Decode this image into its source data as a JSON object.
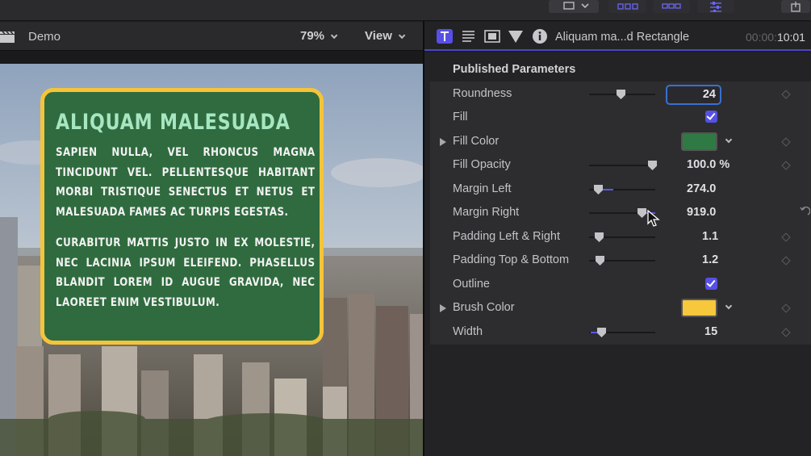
{
  "colors": {
    "accent": "#5650e6",
    "card_fill": "#2f6b3e",
    "card_border": "#f4c43a",
    "card_title": "#a6e6c1",
    "fill_color_swatch": "#2f7a44",
    "brush_color_swatch": "#f7c73c"
  },
  "icons": {
    "toolbar": [
      "display-icon",
      "chevron-down-icon",
      "grid-view-icon",
      "filmstrip-icon",
      "sliders-icon",
      "share-icon"
    ],
    "viewer": [
      "clapperboard-icon"
    ],
    "inspector_tabs": [
      "text-inspector-icon",
      "title-inspector-icon",
      "video-inspector-icon",
      "filter-icon",
      "info-icon"
    ],
    "row_actions": [
      "keyframe-diamond-icon",
      "reset-arrow-icon",
      "triangle-disclosure-icon",
      "mouse-pointer-icon"
    ]
  },
  "viewer": {
    "project_name": "Demo",
    "zoom": "79%",
    "view_menu": "View",
    "card": {
      "title": "ALIQUAM MALESUADA",
      "paragraph1": "SAPIEN NULLA, VEL RHONCUS MAGNA TINCIDUNT VEL. PELLENTESQUE HABITANT MORBI TRISTIQUE SENECTUS ET NETUS ET MALESUADA FAMES AC TURPIS EGESTAS.",
      "paragraph2": "CURABITUR MATTIS JUSTO IN EX MOLESTIE, NEC LACINIA IPSUM ELEIFEND. PHASELLUS BLANDIT LOREM ID AUGUE GRAVIDA, NEC LAOREET ENIM VESTIBULUM."
    }
  },
  "inspector": {
    "title": "Aliquam ma...d Rectangle",
    "timecode_dim": "00:00:",
    "timecode_bright": "10:01",
    "section_title": "Published Parameters",
    "params": {
      "roundness": {
        "label": "Roundness",
        "value": "24",
        "slider_fraction": 0.47
      },
      "fill": {
        "label": "Fill",
        "checked": true
      },
      "fill_color": {
        "label": "Fill Color"
      },
      "fill_opacity": {
        "label": "Fill Opacity",
        "value": "100.0 %",
        "slider_fraction": 0.97
      },
      "margin_left": {
        "label": "Margin Left",
        "value": "274.0",
        "slider_fraction": 0.1
      },
      "margin_right": {
        "label": "Margin Right",
        "value": "919.0",
        "slider_fraction": 0.78
      },
      "padding_lr": {
        "label": "Padding Left & Right",
        "value": "1.1",
        "slider_fraction": 0.08
      },
      "padding_tb": {
        "label": "Padding Top & Bottom",
        "value": "1.2",
        "slider_fraction": 0.09
      },
      "outline": {
        "label": "Outline",
        "checked": true
      },
      "brush_color": {
        "label": "Brush Color"
      },
      "width": {
        "label": "Width",
        "value": "15",
        "slider_fraction": 0.12
      }
    }
  }
}
